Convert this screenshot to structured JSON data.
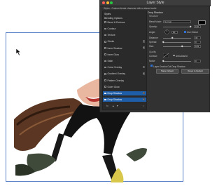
{
  "dialog": {
    "title": "Layer Style",
    "caption": "Styles - Custom Iterate character with a relaxed smile",
    "styles_header": "Styles",
    "blending_options": "Blending Options",
    "effects": [
      {
        "label": "Bevel & Emboss",
        "checked": false,
        "plus": false
      },
      {
        "label": "Contour",
        "checked": false,
        "plus": false
      },
      {
        "label": "Texture",
        "checked": false,
        "plus": false
      },
      {
        "label": "Stroke",
        "checked": false,
        "plus": true
      },
      {
        "label": "Inner Shadow",
        "checked": false,
        "plus": true
      },
      {
        "label": "Inner Glow",
        "checked": false,
        "plus": false
      },
      {
        "label": "Satin",
        "checked": false,
        "plus": false
      },
      {
        "label": "Color Overlay",
        "checked": false,
        "plus": true
      },
      {
        "label": "Gradient Overlay",
        "checked": false,
        "plus": true
      },
      {
        "label": "Pattern Overlay",
        "checked": false,
        "plus": false
      },
      {
        "label": "Outer Glow",
        "checked": false,
        "plus": false
      },
      {
        "label": "Drop Shadow",
        "checked": true,
        "plus": true,
        "selected": true
      },
      {
        "label": "Drop Shadow",
        "checked": true,
        "plus": true,
        "selected": true
      }
    ],
    "fx_label": "fx",
    "drop_shadow": {
      "section": "Drop Shadow",
      "structure": "Structure",
      "blend_mode_label": "Blend Mode:",
      "blend_mode": "Normal",
      "opacity_label": "Opacity:",
      "opacity": "100",
      "angle_label": "Angle:",
      "angle": "90",
      "use_global_light": "Use Global",
      "distance_label": "Distance:",
      "spread_label": "Spread:",
      "size_label": "Size:",
      "distance": "30",
      "spread": "0",
      "size": "109",
      "quality": "Quality",
      "contour_label": "Contour:",
      "anti_aliased": "Anti-aliased",
      "noise_label": "Noise:",
      "noise": "0",
      "layer_knocks_out": "Layer Knocks Out Drop Shadow",
      "make_default": "Make Default",
      "reset_to_default": "Reset to Default"
    }
  },
  "colors": {
    "dialog_bg": "#323232",
    "selection": "#1e5da8",
    "frame": "#5a83c8"
  }
}
